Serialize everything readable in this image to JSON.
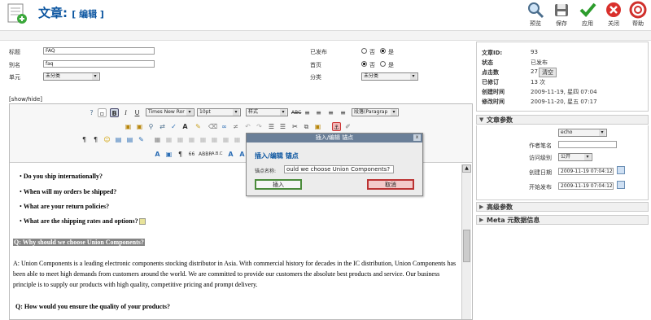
{
  "header": {
    "title": "文章:",
    "subtitle": "[ 编辑 ]",
    "buttons": {
      "preview": "预览",
      "save": "保存",
      "apply": "应用",
      "close": "关闭",
      "help": "帮助"
    }
  },
  "form": {
    "title_label": "标题",
    "title_value": "FAQ",
    "alias_label": "别名",
    "alias_value": "faq",
    "section_label": "单元",
    "section_value": "未分类",
    "published_label": "已发布",
    "frontpage_label": "首页",
    "category_label": "分类",
    "no_label": "否",
    "yes_label": "是",
    "category_value": "未分类"
  },
  "editor": {
    "showhide": "[show/hide]",
    "font_family": "Times New Ror",
    "font_size": "10pt",
    "style": "样式",
    "format": "段落(Paragrap",
    "lines": [
      "Do you ship internationally?",
      "When will my orders be shipped?",
      "What are your return policies?",
      "What are the shipping rates and options?"
    ],
    "highlight_q": "Q: Why should we choose Union Components?",
    "answer": "A: Union Components is a leading electronic components stocking distributor in Asia. With commercial history for decades in the IC distribution, Union Components has been able to meet high demands from customers around the world. We are committed to provide our customers the absolute best products and service. Our business principle is to supply our products with high quality, competitive pricing and prompt delivery.",
    "next_q": "Q: How would you ensure the quality of your products?"
  },
  "dialog": {
    "bar_title": "插入/编辑 锚点",
    "close": "x",
    "heading": "插入/编辑 锚点",
    "field_label": "锚点名称:",
    "field_value": "ould we choose Union Components?",
    "insert": "插入",
    "cancel": "取消"
  },
  "info": {
    "id_label": "文章ID:",
    "id_value": "93",
    "state_label": "状态",
    "state_value": "已发布",
    "hits_label": "点击数",
    "hits_value": "27",
    "reset": "清空",
    "revised_label": "已修订",
    "revised_value": "13 次",
    "created_label": "创建时间",
    "created_value": "2009-11-19, 星四 07:04",
    "modified_label": "修改时间",
    "modified_value": "2009-11-20, 星五 07:17"
  },
  "params": {
    "panel_title": "文章参数",
    "author_label": "作者",
    "author_value": "echo",
    "alias_label": "作者笔名",
    "access_label": "访问级别",
    "access_value": "公开",
    "created_label": "创建日期",
    "created_value": "2009-11-19 07:04:12",
    "publish_label": "开始发布",
    "publish_value": "2009-11-19 07:04:12",
    "advanced_title": "高级参数",
    "meta_title": "Meta 元数据信息"
  }
}
